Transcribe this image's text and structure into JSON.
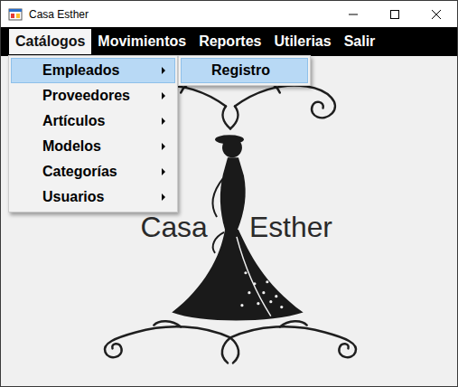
{
  "window": {
    "title": "Casa Esther"
  },
  "menu_bar": [
    {
      "label": "Catálogos",
      "selected": true
    },
    {
      "label": "Movimientos",
      "selected": false
    },
    {
      "label": "Reportes",
      "selected": false
    },
    {
      "label": "Utilerias",
      "selected": false
    },
    {
      "label": "Salir",
      "selected": false
    }
  ],
  "dropdown": [
    {
      "label": "Empleados",
      "selected": true,
      "has_submenu": true
    },
    {
      "label": "Proveedores",
      "selected": false,
      "has_submenu": true
    },
    {
      "label": "Artículos",
      "selected": false,
      "has_submenu": true
    },
    {
      "label": "Modelos",
      "selected": false,
      "has_submenu": true
    },
    {
      "label": "Categorías",
      "selected": false,
      "has_submenu": true
    },
    {
      "label": "Usuarios",
      "selected": false,
      "has_submenu": true
    }
  ],
  "submenu": [
    {
      "label": "Registro",
      "selected": true
    }
  ],
  "logo": {
    "words": [
      "Casa",
      "Esther"
    ]
  }
}
